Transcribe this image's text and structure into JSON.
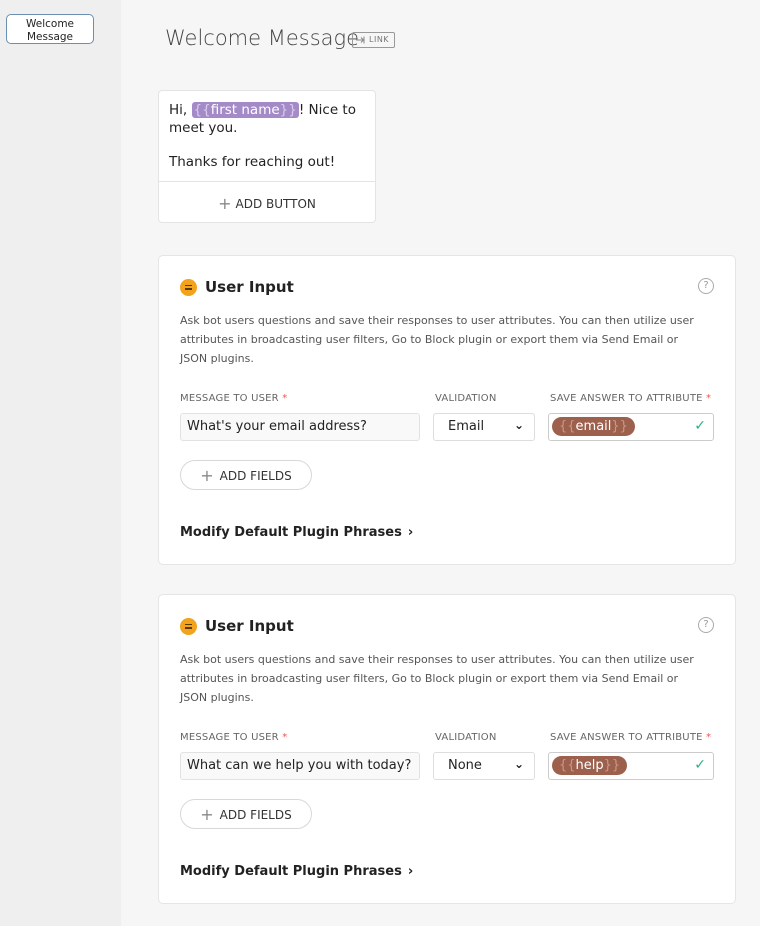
{
  "sidebar": {
    "tab_label": "Welcome Message"
  },
  "header": {
    "title": "Welcome Message",
    "link_badge": "LINK"
  },
  "message_card": {
    "greeting_prefix": "Hi, ",
    "var_open": "{{",
    "var_name": "first name",
    "var_close": "}}",
    "greeting_suffix": "! Nice to meet you.",
    "line2": "Thanks for reaching out!",
    "add_button_label": "ADD BUTTON"
  },
  "user_input_cards": [
    {
      "title": "User Input",
      "description": "Ask bot users questions and save their responses to user attributes. You can then utilize user attributes in broadcasting user filters, Go to Block plugin or export them via Send Email or JSON plugins.",
      "message_label": "MESSAGE TO USER",
      "validation_label": "VALIDATION",
      "attribute_label": "SAVE ANSWER TO ATTRIBUTE",
      "required_mark": "*",
      "message_value": "What's your email address?",
      "validation_value": "Email",
      "attr_open": "{{",
      "attribute_value": "email",
      "attr_close": "}}",
      "add_fields_label": "ADD FIELDS",
      "modify_label": "Modify Default Plugin Phrases"
    },
    {
      "title": "User Input",
      "description": "Ask bot users questions and save their responses to user attributes. You can then utilize user attributes in broadcasting user filters, Go to Block plugin or export them via Send Email or JSON plugins.",
      "message_label": "MESSAGE TO USER",
      "validation_label": "VALIDATION",
      "attribute_label": "SAVE ANSWER TO ATTRIBUTE",
      "required_mark": "*",
      "message_value": "What can we help you with today?",
      "validation_value": "None",
      "attr_open": "{{",
      "attribute_value": "help",
      "attr_close": "}}",
      "add_fields_label": "ADD FIELDS",
      "modify_label": "Modify Default Plugin Phrases"
    }
  ],
  "colors": {
    "variable_pill": "#a48bc8",
    "attribute_pill": "#9c604d",
    "plugin_icon": "#f2a21b",
    "check": "#2bb27c"
  },
  "icons": [
    "link-icon",
    "plus-icon",
    "user-input-icon",
    "help-icon",
    "chevron-down-icon",
    "check-icon",
    "chevron-right-icon"
  ]
}
